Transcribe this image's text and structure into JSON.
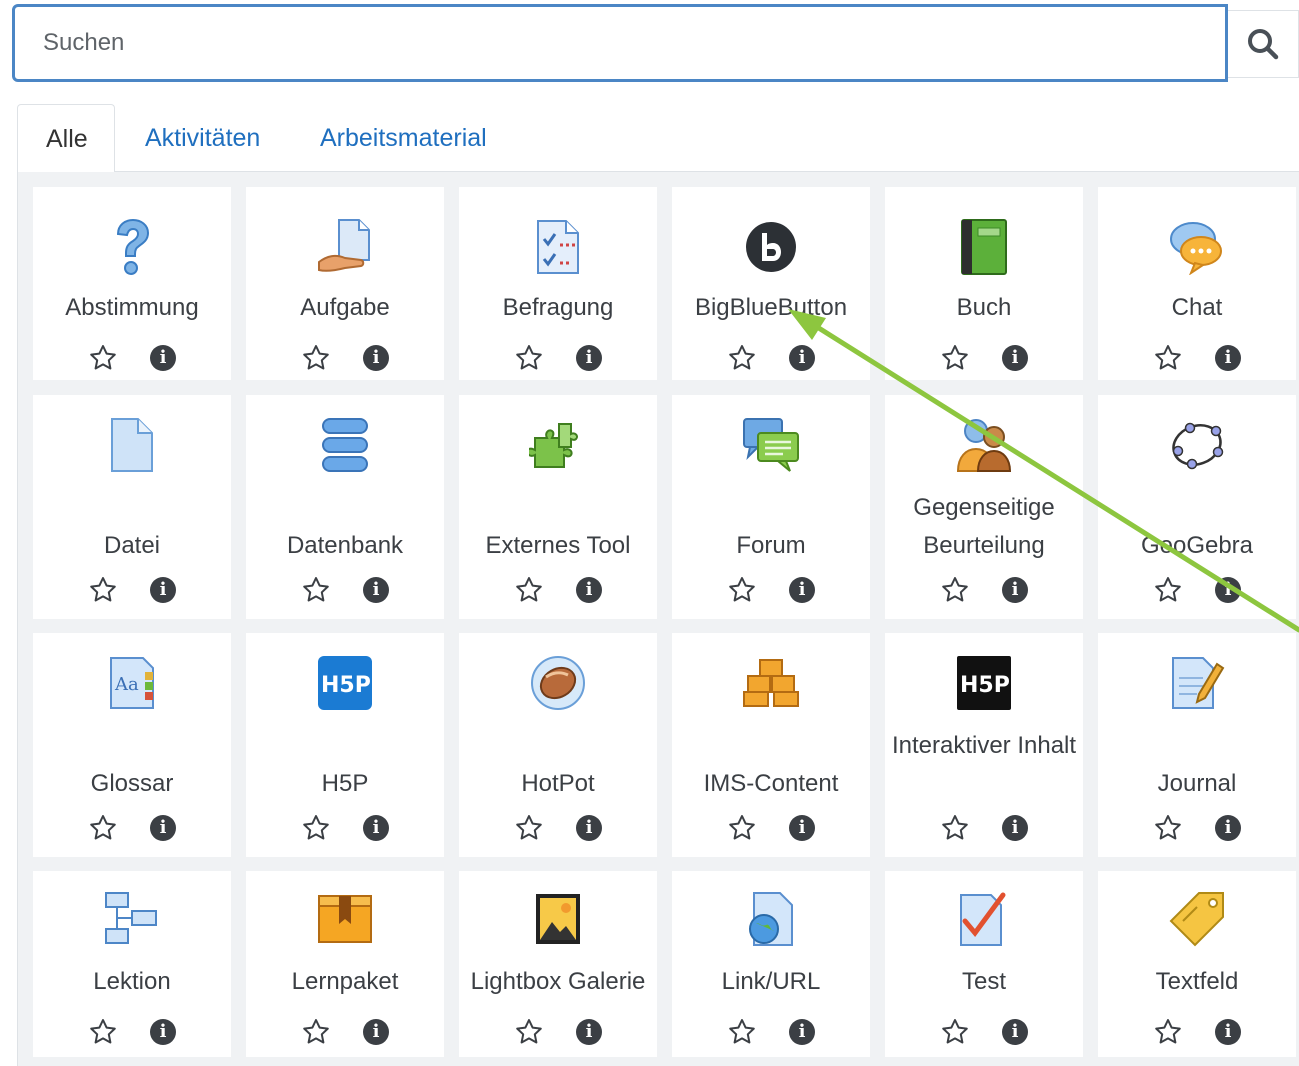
{
  "search": {
    "placeholder": "Suchen",
    "value": ""
  },
  "tabs": [
    {
      "label": "Alle",
      "active": true
    },
    {
      "label": "Aktivitäten",
      "active": false
    },
    {
      "label": "Arbeitsmaterial",
      "active": false
    }
  ],
  "modules": [
    {
      "label": "Abstimmung",
      "icon": "question-mark-icon"
    },
    {
      "label": "Aufgabe",
      "icon": "assignment-hand-icon"
    },
    {
      "label": "Befragung",
      "icon": "survey-checklist-icon"
    },
    {
      "label": "BigBlueButton",
      "icon": "bigbluebutton-logo-icon"
    },
    {
      "label": "Buch",
      "icon": "green-book-icon"
    },
    {
      "label": "Chat",
      "icon": "chat-bubbles-icon"
    },
    {
      "label": "Datei",
      "icon": "file-icon"
    },
    {
      "label": "Datenbank",
      "icon": "database-icon"
    },
    {
      "label": "Externes Tool",
      "icon": "puzzle-piece-icon"
    },
    {
      "label": "Forum",
      "icon": "forum-bubbles-icon"
    },
    {
      "label": "Gegenseitige Beurteilung",
      "icon": "peer-review-people-icon"
    },
    {
      "label": "GeoGebra",
      "icon": "geogebra-ellipse-icon"
    },
    {
      "label": "Glossar",
      "icon": "glossary-aa-icon"
    },
    {
      "label": "H5P",
      "icon": "h5p-blue-icon"
    },
    {
      "label": "HotPot",
      "icon": "hotpot-potato-icon"
    },
    {
      "label": "IMS-Content",
      "icon": "ims-boxes-icon"
    },
    {
      "label": "Interaktiver Inhalt",
      "icon": "h5p-black-icon"
    },
    {
      "label": "Journal",
      "icon": "journal-pencil-icon"
    },
    {
      "label": "Lektion",
      "icon": "lesson-tree-icon"
    },
    {
      "label": "Lernpaket",
      "icon": "scorm-package-icon"
    },
    {
      "label": "Lightbox Galerie",
      "icon": "picture-frame-icon"
    },
    {
      "label": "Link/URL",
      "icon": "link-globe-icon"
    },
    {
      "label": "Test",
      "icon": "quiz-checkmark-icon"
    },
    {
      "label": "Textfeld",
      "icon": "label-tag-icon"
    }
  ],
  "colors": {
    "link": "#1f6fbf",
    "search_border": "#4b86c5",
    "annotation_arrow": "#8dc63f",
    "panel_bg": "#f0f2f4"
  }
}
